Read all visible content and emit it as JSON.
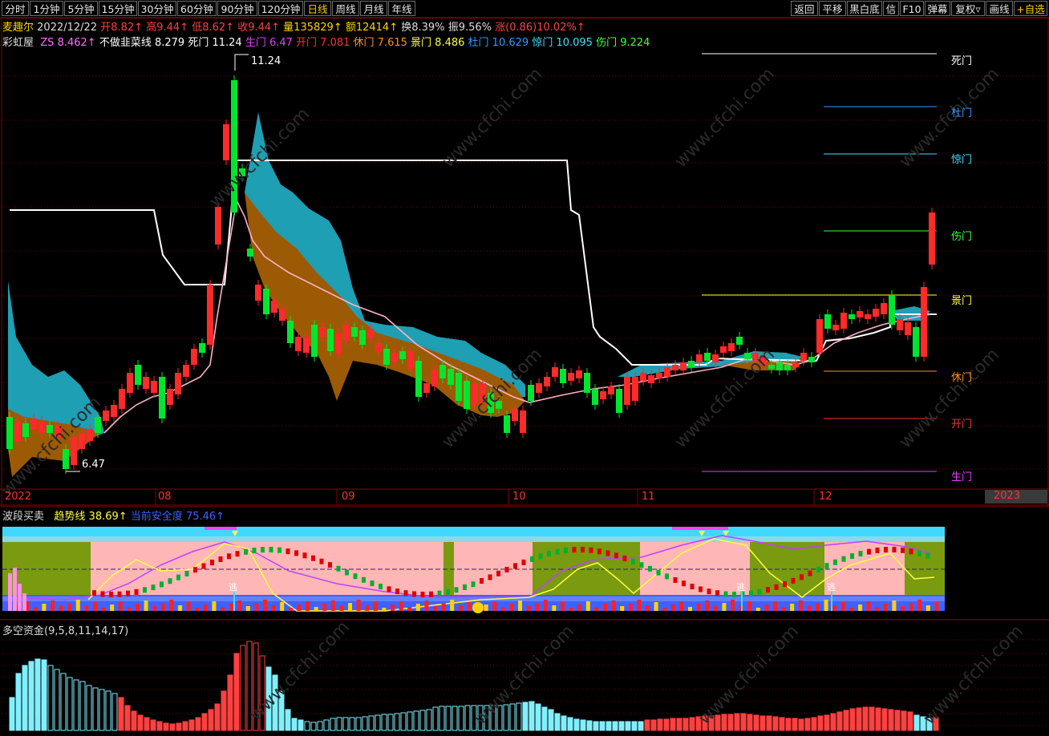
{
  "toolbar": {
    "left_tabs": [
      "分时",
      "1分钟",
      "5分钟",
      "15分钟",
      "30分钟",
      "60分钟",
      "90分钟",
      "120分钟",
      "日线",
      "周线",
      "月线",
      "年线"
    ],
    "active_tab": "日线",
    "right_buttons": [
      "返回",
      "平移",
      "黑白底",
      "信",
      "F10",
      "弹幕",
      "复权▿",
      "画线",
      "+自选"
    ]
  },
  "stock": {
    "name": "麦趣尔",
    "date": "2022/12/22",
    "open": "开8.82↑",
    "high": "高9.44↑",
    "low": "低8.62↑",
    "close": "收9.44↑",
    "volume": "量135829↑",
    "amount": "额12414↑",
    "turnover": "换8.39%",
    "amplitude": "振9.56%",
    "change": "涨(0.86)10.02%↑"
  },
  "indicator_main": {
    "name": "彩虹屋",
    "zs": "ZS 8.462↑",
    "bzcx": "不做韭菜线 8.279",
    "simen": "死门 11.24",
    "shengmen": "生门 6.47",
    "kaimen": "开门 7.081",
    "xiumen": "休门 7.615",
    "jingmen": "景门 8.486",
    "dumen": "杜门 10.629",
    "jingmen2": "惊门 10.095",
    "shangmen": "伤门 9.224"
  },
  "gate_labels": {
    "simen": "死门",
    "dumen": "杜门",
    "jingmen2": "惊门",
    "shangmen": "伤门",
    "jingmen": "景门",
    "xiumen": "休门",
    "kaimen": "开门",
    "shengmen": "生门"
  },
  "price_markers": {
    "high": "11.24",
    "low": "6.47"
  },
  "x_axis": {
    "labels": [
      "2022",
      "08",
      "09",
      "10",
      "11",
      "12"
    ],
    "next_year": "2023"
  },
  "panel2": {
    "title": "波段买卖",
    "trend": "趋势线 38.69↑",
    "safety": "当前安全度 75.46↑",
    "escape_label": "逃"
  },
  "panel3": {
    "title": "多空资金(9,5,8,11,14,17)"
  },
  "watermark": "www.cfchi.com",
  "colors": {
    "up": "#ff2a2a",
    "down": "#00e62e",
    "cyan_band": "#1e9fb4",
    "brown_band": "#9c5a05",
    "pink_line": "#ffb0c8",
    "white_line": "#ffffff",
    "bar_cyan": "#80f0ff",
    "bar_red": "#ff4040"
  }
}
